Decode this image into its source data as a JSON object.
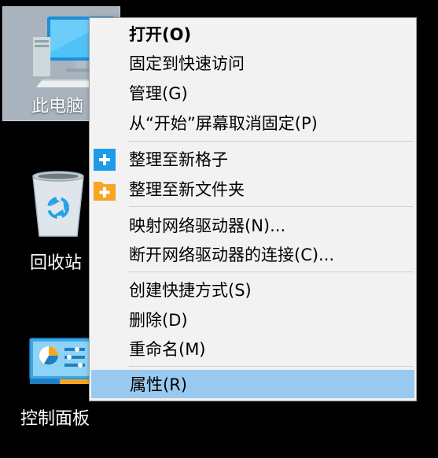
{
  "desktop": {
    "icons": [
      {
        "label": "此电脑"
      },
      {
        "label": "回收站"
      },
      {
        "label": "控制面板"
      }
    ]
  },
  "context_menu": {
    "items": [
      {
        "label": "打开(O)"
      },
      {
        "label": "固定到快速访问"
      },
      {
        "label": "管理(G)"
      },
      {
        "label": "从“开始”屏幕取消固定(P)"
      },
      {
        "label": "整理至新格子",
        "icon": "blue-plus-tile-icon"
      },
      {
        "label": "整理至新文件夹",
        "icon": "orange-plus-folder-icon"
      },
      {
        "label": "映射网络驱动器(N)..."
      },
      {
        "label": "断开网络驱动器的连接(C)..."
      },
      {
        "label": "创建快捷方式(S)"
      },
      {
        "label": "删除(D)"
      },
      {
        "label": "重命名(M)"
      },
      {
        "label": "属性(R)"
      }
    ],
    "selected_index": 11
  },
  "colors": {
    "menu_bg": "#f2f2f2",
    "highlight": "#99c9ef",
    "tile_blue": "#1e9be8",
    "folder_orange": "#f5a623"
  }
}
